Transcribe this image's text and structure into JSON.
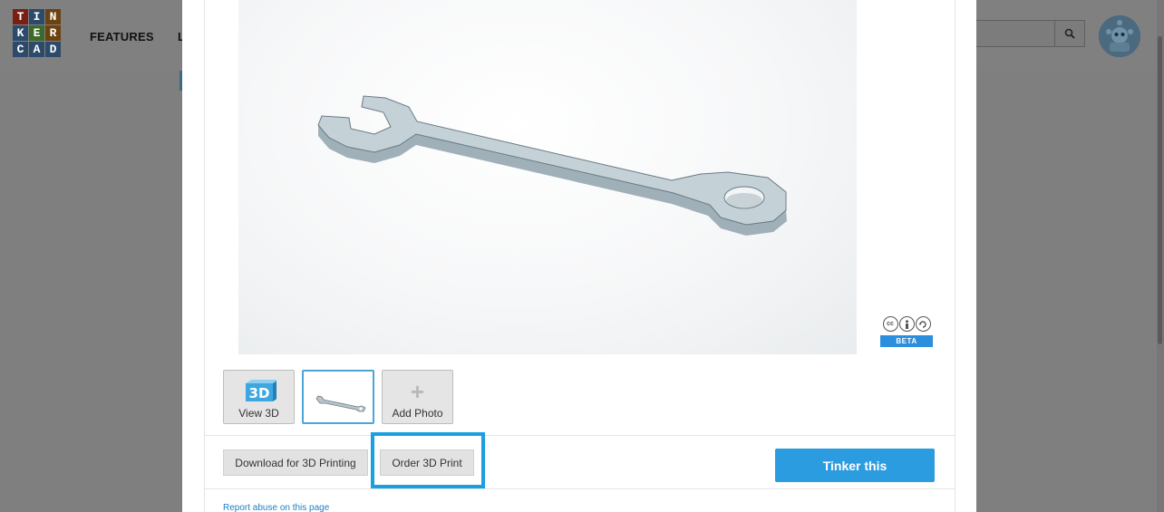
{
  "logo": {
    "letters": [
      "T",
      "I",
      "N",
      "K",
      "E",
      "R",
      "C",
      "A",
      "D"
    ]
  },
  "nav": {
    "features_label": "FEATURES",
    "partial_label": "L"
  },
  "header": {
    "search_icon": "search-icon",
    "avatar_icon": "robot-avatar"
  },
  "viewer": {
    "model": "wrench",
    "license_icons": [
      "cc",
      "by",
      "sa"
    ],
    "beta_label": "BETA"
  },
  "thumbnails": {
    "view3d_label": "View 3D",
    "view3d_badge": "3D",
    "add_photo_label": "Add Photo"
  },
  "actions": {
    "download_label": "Download for 3D Printing",
    "order_label": "Order 3D Print",
    "tinker_label": "Tinker this"
  },
  "footer": {
    "report_label": "Report abuse on this page"
  },
  "colors": {
    "accent": "#2c9ce0",
    "highlight": "#1a9fe0",
    "beta": "#2c8fdd"
  }
}
